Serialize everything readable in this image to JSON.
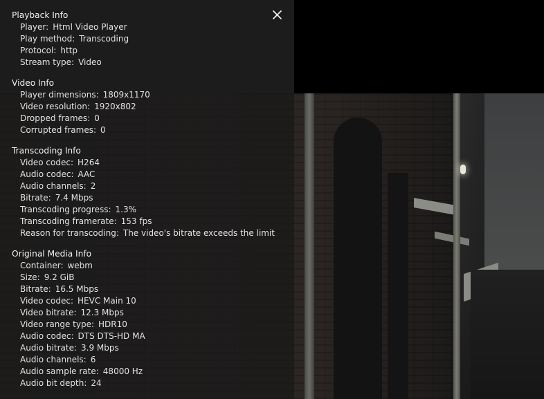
{
  "sections": [
    {
      "title": "Playback Info",
      "rows": [
        {
          "label": "Player",
          "value": "Html Video Player"
        },
        {
          "label": "Play method",
          "value": "Transcoding"
        },
        {
          "label": "Protocol",
          "value": "http"
        },
        {
          "label": "Stream type",
          "value": "Video"
        }
      ]
    },
    {
      "title": "Video Info",
      "rows": [
        {
          "label": "Player dimensions",
          "value": "1809x1170"
        },
        {
          "label": "Video resolution",
          "value": "1920x802"
        },
        {
          "label": "Dropped frames",
          "value": "0"
        },
        {
          "label": "Corrupted frames",
          "value": "0"
        }
      ]
    },
    {
      "title": "Transcoding Info",
      "rows": [
        {
          "label": "Video codec",
          "value": "H264"
        },
        {
          "label": "Audio codec",
          "value": "AAC"
        },
        {
          "label": "Audio channels",
          "value": "2"
        },
        {
          "label": "Bitrate",
          "value": "7.4 Mbps"
        },
        {
          "label": "Transcoding progress",
          "value": "1.3%"
        },
        {
          "label": "Transcoding framerate",
          "value": "153 fps"
        },
        {
          "label": "Reason for transcoding",
          "value": "The video's bitrate exceeds the limit"
        }
      ]
    },
    {
      "title": "Original Media Info",
      "rows": [
        {
          "label": "Container",
          "value": "webm"
        },
        {
          "label": "Size",
          "value": "9.2 GiB"
        },
        {
          "label": "Bitrate",
          "value": "16.5 Mbps"
        },
        {
          "label": "Video codec",
          "value": "HEVC Main 10"
        },
        {
          "label": "Video bitrate",
          "value": "12.3 Mbps"
        },
        {
          "label": "Video range type",
          "value": "HDR10"
        },
        {
          "label": "Audio codec",
          "value": "DTS DTS-HD MA"
        },
        {
          "label": "Audio bitrate",
          "value": "3.9 Mbps"
        },
        {
          "label": "Audio channels",
          "value": "6"
        },
        {
          "label": "Audio sample rate",
          "value": "48000 Hz"
        },
        {
          "label": "Audio bit depth",
          "value": "24"
        }
      ]
    }
  ],
  "icons": {
    "close": "close-icon"
  },
  "colors": {
    "text": "#e8e8e8",
    "overlay": "#181818"
  }
}
